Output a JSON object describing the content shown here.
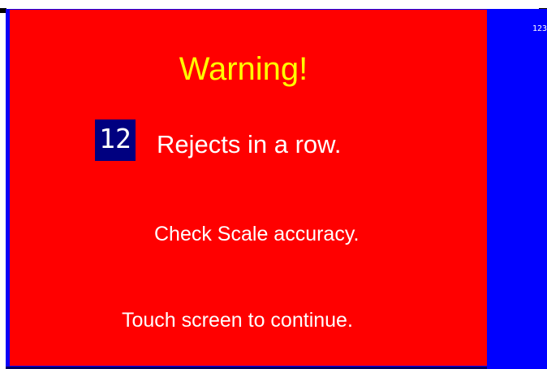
{
  "screen": {
    "side_readout": "123"
  },
  "warning": {
    "title": "Warning!",
    "reject_count": "12",
    "reject_label": "Rejects in a row.",
    "check_message": "Check Scale accuracy.",
    "continue_message": "Touch screen to continue."
  },
  "colors": {
    "panel_red": "#ff0000",
    "side_blue": "#0000ff",
    "title_yellow": "#ffff00",
    "count_box_navy": "#000080",
    "text_white": "#ffffff"
  }
}
